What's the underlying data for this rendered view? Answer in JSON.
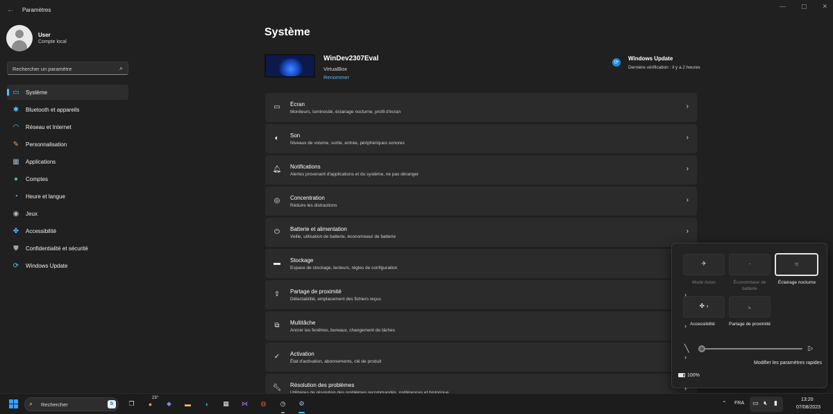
{
  "window": {
    "title": "Paramètres",
    "back_glyph": "←",
    "minimize_glyph": "—",
    "maximize_glyph": "▢",
    "close_glyph": "✕"
  },
  "user": {
    "name": "User",
    "account": "Compte local"
  },
  "search": {
    "placeholder": "Rechercher un paramètre"
  },
  "sidebar": {
    "items": [
      {
        "label": "Système",
        "icon": "monitor-icon",
        "glyph": "▭",
        "color": "#4cc2ff",
        "active": true
      },
      {
        "label": "Bluetooth et appareils",
        "icon": "bluetooth-icon",
        "glyph": "✱",
        "color": "#4cc2ff"
      },
      {
        "label": "Réseau et Internet",
        "icon": "wifi-icon",
        "glyph": "◠",
        "color": "#4cc2ff"
      },
      {
        "label": "Personnalisation",
        "icon": "brush-icon",
        "glyph": "✎",
        "color": "#f0a060"
      },
      {
        "label": "Applications",
        "icon": "apps-icon",
        "glyph": "▦",
        "color": "#a0b0c8"
      },
      {
        "label": "Comptes",
        "icon": "person-icon",
        "glyph": "●",
        "color": "#3cc68a"
      },
      {
        "label": "Heure et langue",
        "icon": "globe-clock-icon",
        "glyph": "◔",
        "color": "#4cc2ff"
      },
      {
        "label": "Jeux",
        "icon": "gamepad-icon",
        "glyph": "◉",
        "color": "#bbbbbb"
      },
      {
        "label": "Accessibilité",
        "icon": "accessibility-icon",
        "glyph": "✤",
        "color": "#4cc2ff"
      },
      {
        "label": "Confidentialité et sécurité",
        "icon": "shield-icon",
        "glyph": "⛊",
        "color": "#9aa4b0"
      },
      {
        "label": "Windows Update",
        "icon": "update-icon",
        "glyph": "⟳",
        "color": "#4cc2ff"
      }
    ]
  },
  "main": {
    "title": "Système",
    "device": {
      "name": "WinDev2307Eval",
      "subtitle": "VirtualBox",
      "rename": "Renommer"
    },
    "windows_update": {
      "title": "Windows Update",
      "subtitle": "Dernière vérification : il y a 2 heures"
    },
    "cards": [
      {
        "title": "Écran",
        "subtitle": "Moniteurs, luminosité, éclairage nocturne, profil d'écran",
        "icon": "display-icon",
        "glyph": "▭"
      },
      {
        "title": "Son",
        "subtitle": "Niveaux de volume, sortie, entrée, périphériques sonores",
        "icon": "speaker-icon",
        "glyph": "🔈︎"
      },
      {
        "title": "Notifications",
        "subtitle": "Alertes provenant d'applications et du système, ne pas déranger",
        "icon": "bell-icon",
        "glyph": "🔔︎"
      },
      {
        "title": "Concentration",
        "subtitle": "Réduire les distractions",
        "icon": "focus-icon",
        "glyph": "◎"
      },
      {
        "title": "Batterie et alimentation",
        "subtitle": "Veille, utilisation de batterie, économiseur de batterie",
        "icon": "power-icon",
        "glyph": "⏻"
      },
      {
        "title": "Stockage",
        "subtitle": "Espace de stockage, lecteurs, règles de configuration",
        "icon": "storage-icon",
        "glyph": "▬"
      },
      {
        "title": "Partage de proximité",
        "subtitle": "Détectabilité, emplacement des fichiers reçus",
        "icon": "share-icon",
        "glyph": "⇪"
      },
      {
        "title": "Multitâche",
        "subtitle": "Ancrer les fenêtres, bureaux, changement de tâches",
        "icon": "multitask-icon",
        "glyph": "⧉"
      },
      {
        "title": "Activation",
        "subtitle": "État d'activation, abonnements, clé de produit",
        "icon": "check-circle-icon",
        "glyph": "✓"
      },
      {
        "title": "Résolution des problèmes",
        "subtitle": "Utilitaires de résolution des problèmes recommandés, préférences et historique",
        "icon": "wrench-icon",
        "glyph": "🔧︎"
      }
    ]
  },
  "quick_settings": {
    "tiles": [
      {
        "label": "Mode Avion",
        "icon": "airplane-icon",
        "glyph": "✈",
        "state": "disabled"
      },
      {
        "label": "Économiseur de batterie",
        "icon": "battery-saver-icon",
        "glyph": "·",
        "state": "disabled"
      },
      {
        "label": "Éclairage nocturne",
        "icon": "night-light-icon",
        "glyph": "☼",
        "state": "on"
      },
      {
        "label": "Accessibilité",
        "icon": "accessibility-icon",
        "glyph": "✤ ›",
        "state": "on"
      },
      {
        "label": "Partage de proximité",
        "icon": "share-icon",
        "glyph": "⌞",
        "state": "on"
      }
    ],
    "brightness": 0.0,
    "edit_label": "Modifier les paramètres rapides",
    "battery_label": "100%",
    "battery_level": 1.0
  },
  "taskbar": {
    "search_placeholder": "Rechercher",
    "weather_temp": "23°",
    "apps": [
      {
        "icon": "task-view-icon",
        "glyph": "❐",
        "color": "#cfd8e6",
        "state": "none"
      },
      {
        "icon": "weather-icon",
        "glyph": "●",
        "color": "#f0a030",
        "state": "none"
      },
      {
        "icon": "teams-icon",
        "glyph": "◆",
        "color": "#7b83eb",
        "state": "none"
      },
      {
        "icon": "file-explorer-icon",
        "glyph": "▬",
        "color": "#f4c542",
        "state": "none"
      },
      {
        "icon": "edge-icon",
        "glyph": "◐",
        "color": "#2fb4e0",
        "state": "none"
      },
      {
        "icon": "store-icon",
        "glyph": "▦",
        "color": "#e8e8e8",
        "state": "none"
      },
      {
        "icon": "visual-studio-icon",
        "glyph": "⋈",
        "color": "#b07cf0",
        "state": "none"
      },
      {
        "icon": "ubuntu-icon",
        "glyph": "◍",
        "color": "#e95420",
        "state": "none"
      },
      {
        "icon": "clock-app-icon",
        "glyph": "◷",
        "color": "#dddddd",
        "state": "running"
      },
      {
        "icon": "settings-icon",
        "glyph": "⚙",
        "color": "#9fc6ef",
        "state": "active"
      }
    ],
    "language": "FRA",
    "time": "13:20",
    "date": "07/08/2023"
  }
}
